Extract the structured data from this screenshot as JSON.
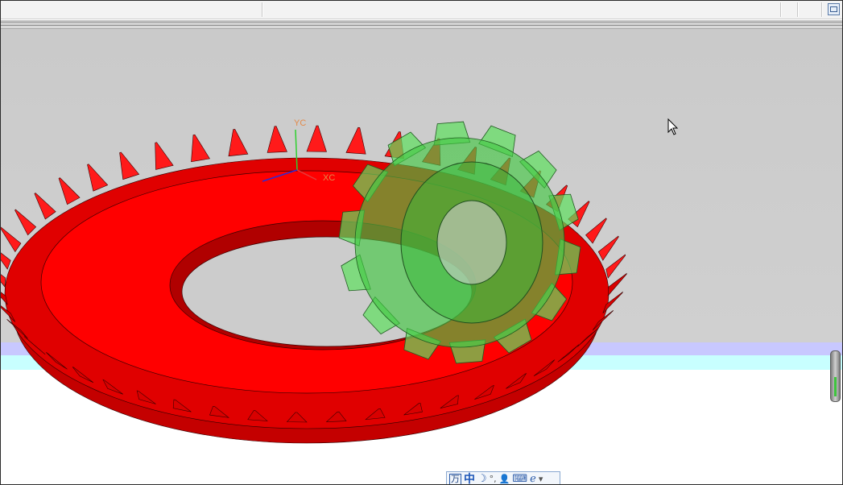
{
  "window": {
    "toolbar_separators": 4,
    "restore_button": "restore-icon"
  },
  "viewport": {
    "background_upper": "#cccccc",
    "band_colors": [
      "#c8c8ff",
      "#c8ffff"
    ],
    "background_lower": "#ffffff",
    "axis_triad": {
      "x_label": "XC",
      "y_label": "YC",
      "x_color": "#e53a3a",
      "y_color": "#2fd02f",
      "z_color": "#2b2bd6",
      "label_color": "#e38a4a"
    },
    "models": [
      {
        "name": "bevel-gear-ring",
        "color": "#ff0000",
        "teeth": 48
      },
      {
        "name": "bevel-pinion-gear",
        "color": "#4fd94f",
        "teeth": 14,
        "transparent": true
      }
    ],
    "cursor": "mouse-pointer-icon"
  },
  "ime_bar": {
    "logo": "万",
    "mode": "中",
    "moon": "☽",
    "punct": "°,",
    "person": "👤",
    "keyboard": "⌨",
    "browser": "ℯ",
    "menu": "▾"
  }
}
